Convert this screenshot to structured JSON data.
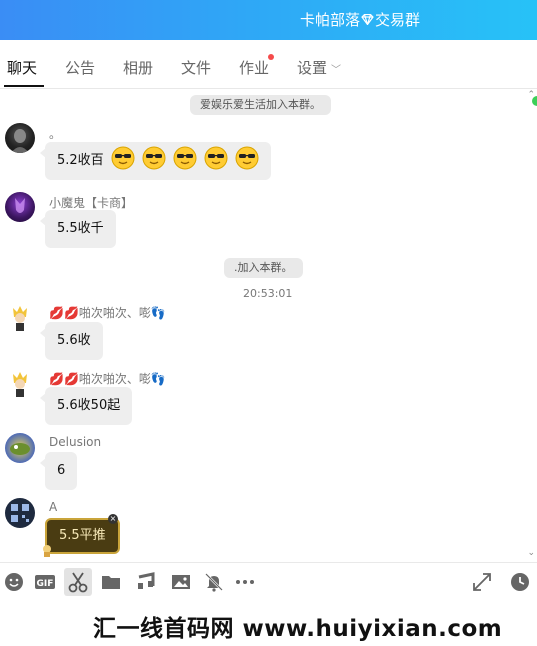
{
  "window": {
    "title_part1": "卡帕部落",
    "title_part2": "交易群",
    "gem_icon": "diamond-icon"
  },
  "tabs": [
    {
      "label": "聊天",
      "active": true
    },
    {
      "label": "公告"
    },
    {
      "label": "相册"
    },
    {
      "label": "文件"
    },
    {
      "label": "作业",
      "badge": "red-dot"
    },
    {
      "label": "设置"
    }
  ],
  "messages": {
    "sys1": "爱娱乐爱生活加入本群。",
    "m1": {
      "nick": "。",
      "text": "5.2收百",
      "emoji": "cool-face"
    },
    "m2": {
      "nick": "小魔鬼【卡商】",
      "text": "5.5收千"
    },
    "sys2": ".加入本群。",
    "time": "20:53:01",
    "m3": {
      "nick": "啪次啪次、嘭",
      "text": "5.6收"
    },
    "m4": {
      "nick": "啪次啪次、嘭",
      "text": "5.6收50起"
    },
    "m5": {
      "nick": "Delusion",
      "text": "6"
    },
    "m6": {
      "nick": "A",
      "text": "5.5平推"
    }
  },
  "toolbar": {
    "icons": [
      "emoji-icon",
      "gif-icon",
      "scissors-icon",
      "folder-icon",
      "music-icon",
      "image-icon",
      "bell-off-icon",
      "more-icon",
      "expand-icon",
      "history-icon"
    ]
  },
  "watermark": {
    "text": "汇一线首码网 www.huiyixian.com"
  },
  "colors": {
    "title_gradient_start": "#3a8df5",
    "title_gradient_end": "#27c2f7",
    "bubble": "#eeeeee",
    "online": "#3ccf58"
  }
}
